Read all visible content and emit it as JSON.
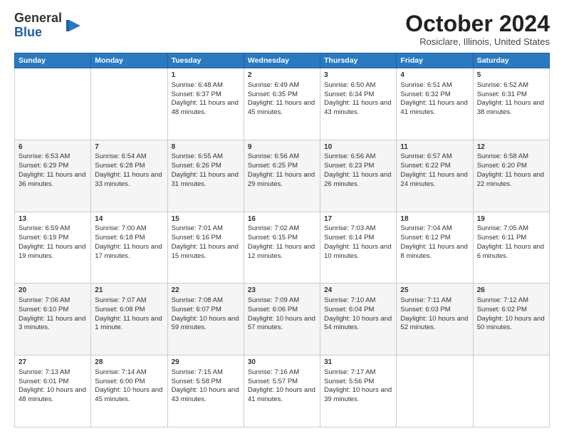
{
  "header": {
    "logo_line1": "General",
    "logo_line2": "Blue",
    "month_year": "October 2024",
    "location": "Rosiclare, Illinois, United States"
  },
  "days_of_week": [
    "Sunday",
    "Monday",
    "Tuesday",
    "Wednesday",
    "Thursday",
    "Friday",
    "Saturday"
  ],
  "weeks": [
    [
      {
        "day": "",
        "sunrise": "",
        "sunset": "",
        "daylight": ""
      },
      {
        "day": "",
        "sunrise": "",
        "sunset": "",
        "daylight": ""
      },
      {
        "day": "1",
        "sunrise": "Sunrise: 6:48 AM",
        "sunset": "Sunset: 6:37 PM",
        "daylight": "Daylight: 11 hours and 48 minutes."
      },
      {
        "day": "2",
        "sunrise": "Sunrise: 6:49 AM",
        "sunset": "Sunset: 6:35 PM",
        "daylight": "Daylight: 11 hours and 45 minutes."
      },
      {
        "day": "3",
        "sunrise": "Sunrise: 6:50 AM",
        "sunset": "Sunset: 6:34 PM",
        "daylight": "Daylight: 11 hours and 43 minutes."
      },
      {
        "day": "4",
        "sunrise": "Sunrise: 6:51 AM",
        "sunset": "Sunset: 6:32 PM",
        "daylight": "Daylight: 11 hours and 41 minutes."
      },
      {
        "day": "5",
        "sunrise": "Sunrise: 6:52 AM",
        "sunset": "Sunset: 6:31 PM",
        "daylight": "Daylight: 11 hours and 38 minutes."
      }
    ],
    [
      {
        "day": "6",
        "sunrise": "Sunrise: 6:53 AM",
        "sunset": "Sunset: 6:29 PM",
        "daylight": "Daylight: 11 hours and 36 minutes."
      },
      {
        "day": "7",
        "sunrise": "Sunrise: 6:54 AM",
        "sunset": "Sunset: 6:28 PM",
        "daylight": "Daylight: 11 hours and 33 minutes."
      },
      {
        "day": "8",
        "sunrise": "Sunrise: 6:55 AM",
        "sunset": "Sunset: 6:26 PM",
        "daylight": "Daylight: 11 hours and 31 minutes."
      },
      {
        "day": "9",
        "sunrise": "Sunrise: 6:56 AM",
        "sunset": "Sunset: 6:25 PM",
        "daylight": "Daylight: 11 hours and 29 minutes."
      },
      {
        "day": "10",
        "sunrise": "Sunrise: 6:56 AM",
        "sunset": "Sunset: 6:23 PM",
        "daylight": "Daylight: 11 hours and 26 minutes."
      },
      {
        "day": "11",
        "sunrise": "Sunrise: 6:57 AM",
        "sunset": "Sunset: 6:22 PM",
        "daylight": "Daylight: 11 hours and 24 minutes."
      },
      {
        "day": "12",
        "sunrise": "Sunrise: 6:58 AM",
        "sunset": "Sunset: 6:20 PM",
        "daylight": "Daylight: 11 hours and 22 minutes."
      }
    ],
    [
      {
        "day": "13",
        "sunrise": "Sunrise: 6:59 AM",
        "sunset": "Sunset: 6:19 PM",
        "daylight": "Daylight: 11 hours and 19 minutes."
      },
      {
        "day": "14",
        "sunrise": "Sunrise: 7:00 AM",
        "sunset": "Sunset: 6:18 PM",
        "daylight": "Daylight: 11 hours and 17 minutes."
      },
      {
        "day": "15",
        "sunrise": "Sunrise: 7:01 AM",
        "sunset": "Sunset: 6:16 PM",
        "daylight": "Daylight: 11 hours and 15 minutes."
      },
      {
        "day": "16",
        "sunrise": "Sunrise: 7:02 AM",
        "sunset": "Sunset: 6:15 PM",
        "daylight": "Daylight: 11 hours and 12 minutes."
      },
      {
        "day": "17",
        "sunrise": "Sunrise: 7:03 AM",
        "sunset": "Sunset: 6:14 PM",
        "daylight": "Daylight: 11 hours and 10 minutes."
      },
      {
        "day": "18",
        "sunrise": "Sunrise: 7:04 AM",
        "sunset": "Sunset: 6:12 PM",
        "daylight": "Daylight: 11 hours and 8 minutes."
      },
      {
        "day": "19",
        "sunrise": "Sunrise: 7:05 AM",
        "sunset": "Sunset: 6:11 PM",
        "daylight": "Daylight: 11 hours and 6 minutes."
      }
    ],
    [
      {
        "day": "20",
        "sunrise": "Sunrise: 7:06 AM",
        "sunset": "Sunset: 6:10 PM",
        "daylight": "Daylight: 11 hours and 3 minutes."
      },
      {
        "day": "21",
        "sunrise": "Sunrise: 7:07 AM",
        "sunset": "Sunset: 6:08 PM",
        "daylight": "Daylight: 11 hours and 1 minute."
      },
      {
        "day": "22",
        "sunrise": "Sunrise: 7:08 AM",
        "sunset": "Sunset: 6:07 PM",
        "daylight": "Daylight: 10 hours and 59 minutes."
      },
      {
        "day": "23",
        "sunrise": "Sunrise: 7:09 AM",
        "sunset": "Sunset: 6:06 PM",
        "daylight": "Daylight: 10 hours and 57 minutes."
      },
      {
        "day": "24",
        "sunrise": "Sunrise: 7:10 AM",
        "sunset": "Sunset: 6:04 PM",
        "daylight": "Daylight: 10 hours and 54 minutes."
      },
      {
        "day": "25",
        "sunrise": "Sunrise: 7:11 AM",
        "sunset": "Sunset: 6:03 PM",
        "daylight": "Daylight: 10 hours and 52 minutes."
      },
      {
        "day": "26",
        "sunrise": "Sunrise: 7:12 AM",
        "sunset": "Sunset: 6:02 PM",
        "daylight": "Daylight: 10 hours and 50 minutes."
      }
    ],
    [
      {
        "day": "27",
        "sunrise": "Sunrise: 7:13 AM",
        "sunset": "Sunset: 6:01 PM",
        "daylight": "Daylight: 10 hours and 48 minutes."
      },
      {
        "day": "28",
        "sunrise": "Sunrise: 7:14 AM",
        "sunset": "Sunset: 6:00 PM",
        "daylight": "Daylight: 10 hours and 45 minutes."
      },
      {
        "day": "29",
        "sunrise": "Sunrise: 7:15 AM",
        "sunset": "Sunset: 5:58 PM",
        "daylight": "Daylight: 10 hours and 43 minutes."
      },
      {
        "day": "30",
        "sunrise": "Sunrise: 7:16 AM",
        "sunset": "Sunset: 5:57 PM",
        "daylight": "Daylight: 10 hours and 41 minutes."
      },
      {
        "day": "31",
        "sunrise": "Sunrise: 7:17 AM",
        "sunset": "Sunset: 5:56 PM",
        "daylight": "Daylight: 10 hours and 39 minutes."
      },
      {
        "day": "",
        "sunrise": "",
        "sunset": "",
        "daylight": ""
      },
      {
        "day": "",
        "sunrise": "",
        "sunset": "",
        "daylight": ""
      }
    ]
  ]
}
